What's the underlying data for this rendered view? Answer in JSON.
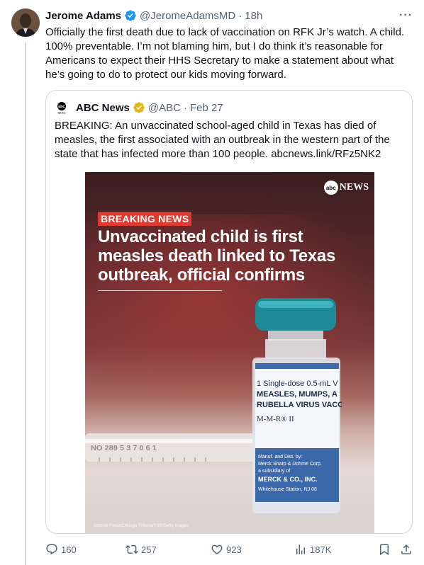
{
  "tweet": {
    "author_name": "Jerome Adams",
    "author_handle": "@JeromeAdamsMD",
    "separator": "·",
    "time": "18h",
    "more_label": "···",
    "text": "Officially the first death due to lack of vaccination on RFK Jr’s watch. A child. 100% preventable. I’m not blaming him, but I do think it’s reasonable for Americans to expect their HHS Secretary to make a statement about what he’s going to do to protect our kids moving forward."
  },
  "quote": {
    "author_name": "ABC News",
    "author_handle": "@ABC",
    "separator": "·",
    "date": "Feb 27",
    "logo_text": "abc",
    "text": "BREAKING: An unvaccinated school-aged child in Texas has died of measles, the first associated with an outbreak in the western part of the state that has infected more than 100 people. ",
    "link": "abcnews.link/RFz5NK2"
  },
  "media": {
    "badge_circle": "abc",
    "badge_text": "NEWS",
    "breaking_label": "BREAKING NEWS",
    "headline": "Unvaccinated child is first measles death linked to Texas outbreak, official confirms",
    "credit": "Antonio Perez/Chicago Tribune/TNS/Getty Images",
    "vial_lines": [
      "1 Single-dose 0.5-mL V",
      "MEASLES, MUMPS, A",
      "RUBELLA VIRUS VACC",
      "M-M-R® II"
    ],
    "vial_maker_lines": [
      "Manuf. and Dist. by:",
      "Merck Sharp & Dohme Corp.",
      "a subsidiary of",
      "MERCK & CO., INC.",
      "Whitehouse Station, NJ 08"
    ],
    "syringe_text": "NO 289 5 3 7 0 6 1"
  },
  "actions": {
    "replies": "160",
    "retweets": "257",
    "likes": "923",
    "views": "187K"
  },
  "colors": {
    "verified_blue": "#1d9bf0",
    "verified_gold": "#e2b719",
    "breaking_red": "#e03a30",
    "muted": "#536471"
  },
  "icons": [
    "verified-badge-icon",
    "more-icon",
    "reply-icon",
    "retweet-icon",
    "like-icon",
    "views-icon",
    "bookmark-icon",
    "share-icon"
  ]
}
